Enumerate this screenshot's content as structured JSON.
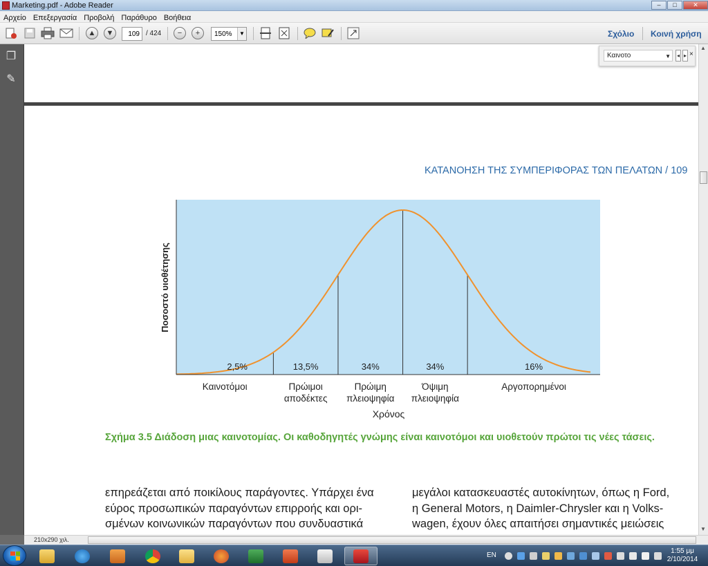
{
  "window": {
    "title": "Marketing.pdf - Adobe Reader",
    "controls": {
      "minimize": "–",
      "maximize": "□",
      "close": "✕"
    }
  },
  "menu": [
    "Αρχείο",
    "Επεξεργασία",
    "Προβολή",
    "Παράθυρο",
    "Βοήθεια"
  ],
  "toolbar": {
    "page_current": "109",
    "page_total": "/ 424",
    "zoom": "150%",
    "comment_label": "Σχόλιο",
    "share_label": "Κοινή χρήση"
  },
  "find": {
    "value": "Καινοτο"
  },
  "document": {
    "running_head": "ΚΑΤΑΝΟΗΣΗ ΤΗΣ ΣΥΜΠΕΡΙΦΟΡΑΣ ΤΩΝ ΠΕΛΑΤΩΝ  /  109",
    "caption": "Σχήμα 3.5  Διάδοση μιας καινοτομίας. Οι καθοδηγητές γνώμης είναι καινοτόμοι και υιοθετούν πρώτοι τις νέες τάσεις.",
    "left_column": [
      "επηρεάζεται από ποικίλους παράγοντες. Υπάρχει ένα",
      "εύρος προσωπικών παραγόντων επιρροής και ορι-",
      "σμένων κοινωνικών παραγόντων που συνδυαστικά"
    ],
    "right_column": [
      "μεγάλοι κατασκευαστές αυτοκίνητων, όπως η Ford,",
      "η General Motors, η Daimler-Chrysler και η Volks-",
      "wagen, έχουν όλες απαιτήσει σημαντικές μειώσεις"
    ]
  },
  "chart_data": {
    "type": "area",
    "ylabel": "Ποσοστό υιοθέτησης",
    "xlabel": "Χρόνος",
    "colors": {
      "background": "#bfe1f5",
      "curve": "#f0922d",
      "divider": "#333333"
    },
    "segments": [
      {
        "label": "Καινοτόμοι",
        "value_label": "2,5%",
        "value": 2.5
      },
      {
        "label": "Πρώιμοι\nαποδέκτες",
        "value_label": "13,5%",
        "value": 13.5
      },
      {
        "label": "Πρώιμη\nπλειοψηφία",
        "value_label": "34%",
        "value": 34
      },
      {
        "label": "Όψιμη\nπλειοψηφία",
        "value_label": "34%",
        "value": 34
      },
      {
        "label": "Αργοπορημένοι",
        "value_label": "16%",
        "value": 16
      }
    ],
    "x_sigma": [
      -3,
      -2,
      -1,
      0,
      1,
      2.3
    ]
  },
  "status": {
    "page_size": "210x290 χιλ."
  },
  "taskbar": {
    "apps": [
      "Windows Explorer",
      "Internet Explorer",
      "Media Player",
      "Chrome",
      "Mail",
      "Firefox",
      "Excel",
      "PowerPoint",
      "Document",
      "Adobe Reader"
    ],
    "lang": "EN",
    "time": "1:55 μμ",
    "date": "2/10/2014"
  }
}
